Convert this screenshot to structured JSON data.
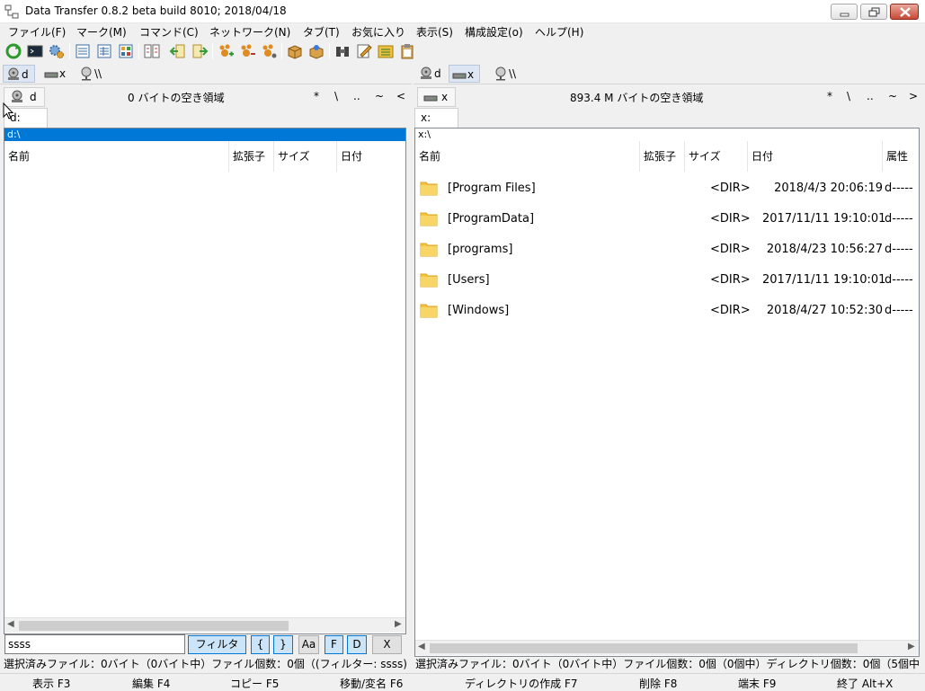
{
  "window": {
    "title": "Data Transfer 0.8.2 beta build 8010; 2018/04/18"
  },
  "menu": [
    "ファイル(F)",
    "マーク(M)",
    "コマンド(C)",
    "ネットワーク(N)",
    "タブ(T)",
    "お気に入り",
    "表示(S)",
    "構成設定(o)",
    "ヘルプ(H)"
  ],
  "toolbar_icons": [
    "refresh-icon",
    "terminal-icon",
    "settings-icon",
    "view-list-icon",
    "view-detail-icon",
    "view-thumbnail-icon",
    "compare-icon",
    "import-icon",
    "export-icon",
    "paw-add-icon",
    "paw-remove-icon",
    "paw-settings-icon",
    "package-icon",
    "package-open-icon",
    "binoculars-icon",
    "edit-icon",
    "folder-tree-icon",
    "clipboard-icon"
  ],
  "left": {
    "drives": [
      "d",
      "x",
      "\\\\"
    ],
    "active_drive": "d",
    "current_drive": "d",
    "free_space": "0 バイトの空き領域",
    "nav": [
      "*",
      "\\",
      "..",
      "~",
      "<"
    ],
    "path_tab": "d:",
    "path": "d:\\",
    "columns": [
      "名前",
      "拡張子",
      "サイズ",
      "日付"
    ],
    "rows": []
  },
  "right": {
    "drives": [
      "d",
      "x",
      "\\\\"
    ],
    "active_drive": "x",
    "current_drive": "x",
    "free_space": "893.4 M バイトの空き領域",
    "nav": [
      "*",
      "\\",
      "..",
      "~",
      ">"
    ],
    "path_tab": "x:",
    "path": "x:\\",
    "columns": [
      "名前",
      "拡張子",
      "サイズ",
      "日付",
      "属性"
    ],
    "rows": [
      {
        "name": "[Program Files]",
        "size": "<DIR>",
        "date": "2018/4/3 20:06:19",
        "attr": "d-----"
      },
      {
        "name": "[ProgramData]",
        "size": "<DIR>",
        "date": "2017/11/11 19:10:01",
        "attr": "d-----"
      },
      {
        "name": "[programs]",
        "size": "<DIR>",
        "date": "2018/4/23 10:56:27",
        "attr": "d-----"
      },
      {
        "name": "[Users]",
        "size": "<DIR>",
        "date": "2017/11/11 19:10:01",
        "attr": "d-----"
      },
      {
        "name": "[Windows]",
        "size": "<DIR>",
        "date": "2018/4/27 10:52:30",
        "attr": "d-----"
      }
    ]
  },
  "filter": {
    "value": "ssss",
    "filter_label": "フィルタ",
    "open_brace": "{",
    "close_brace": "}",
    "case_label": "Aa",
    "f_label": "F",
    "d_label": "D",
    "clear_label": "X"
  },
  "status": {
    "left": "選択済みファイル：0バイト（0バイト中）ファイル個数：0個（(フィルター: ssss)",
    "right": "選択済みファイル：0バイト（0バイト中）ファイル個数：0個（0個中）ディレクトリ個数：0個（5個中"
  },
  "fkeys": [
    "表示 F3",
    "編集 F4",
    "コピー F5",
    "移動/変名 F6",
    "ディレクトリの作成 F7",
    "削除 F8",
    "端末 F9",
    "終了 Alt+X"
  ],
  "colors": {
    "selection": "#0078d7",
    "folder": "#f5c542",
    "border": "#828790"
  }
}
